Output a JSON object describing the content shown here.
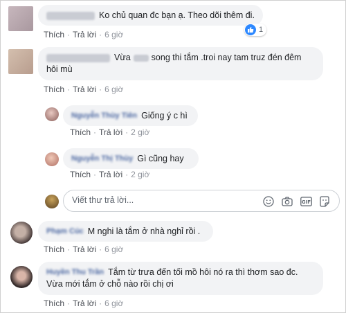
{
  "common": {
    "like_label": "Thích",
    "reply_label": "Trả lời",
    "separator": "·"
  },
  "comments": [
    {
      "text": "Ko chủ quan đc bạn ạ. Theo dõi thêm đi.",
      "time": "6 giờ",
      "reactions": "1"
    },
    {
      "text_before": "Vừa",
      "text_after": "song thi tắm .troi nay tam truz đén đêm hôi mù",
      "time": "6 giờ"
    },
    {
      "author": "Nguyễn Thùy Tiên",
      "text": "Giống ý c hì",
      "time": "2 giờ"
    },
    {
      "author": "Nguyễn Thị Thùy",
      "text": "Gì cũng hay",
      "time": "2 giờ"
    },
    {
      "author": "Phạm Cúc",
      "text": "M nghi là tắm ở nhà nghỉ rồi .",
      "time": "6 giờ"
    },
    {
      "author": "Huyền Thu Trần",
      "text": "Tắm từ trưa đến tối mồ hôi nó ra thì thơm sao đc. Vừa mới tắm ở chỗ nào rồi chị ơi",
      "time": "6 giờ"
    }
  ],
  "reply_box": {
    "placeholder": "Viết thư trả lời..."
  },
  "icons": [
    "emoji-icon",
    "camera-icon",
    "gif-icon",
    "sticker-icon"
  ],
  "colors": {
    "like_blue": "#2d88ff",
    "bubble": "#f2f3f5",
    "meta": "#606770"
  }
}
